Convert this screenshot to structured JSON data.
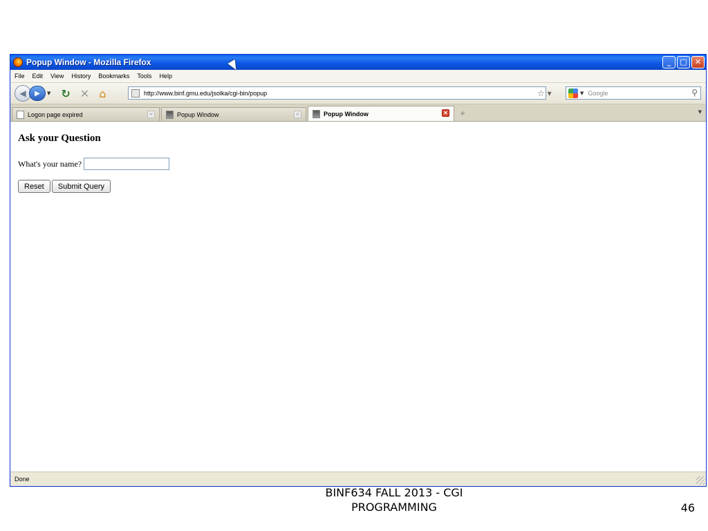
{
  "window": {
    "title": "Popup Window - Mozilla Firefox",
    "controls": [
      "_",
      "□",
      "✕"
    ]
  },
  "menu": [
    "File",
    "Edit",
    "View",
    "History",
    "Bookmarks",
    "Tools",
    "Help"
  ],
  "navbar": {
    "url": "http://www.binf.gmu.edu/jsolka/cgi-bin/popup",
    "search_placeholder": "Google",
    "icons": [
      "back-icon",
      "forward-icon",
      "reload-icon",
      "stop-icon",
      "home-icon",
      "bookmark-star-icon",
      "search-go-icon"
    ]
  },
  "tabs": [
    {
      "label": "Logon page expired",
      "active": false
    },
    {
      "label": "Popup Window",
      "active": false
    },
    {
      "label": "Popup Window",
      "active": true
    }
  ],
  "page": {
    "heading": "Ask your Question",
    "name_label": "What's your name?",
    "name_value": "",
    "reset_label": "Reset",
    "submit_label": "Submit Query"
  },
  "status": "Done",
  "slide": {
    "footer": "BINF634 FALL 2013 - CGI PROGRAMMING",
    "page_number": "46"
  },
  "colors": {
    "titlebar": "#0d57e2",
    "chrome": "#ece9d8"
  }
}
